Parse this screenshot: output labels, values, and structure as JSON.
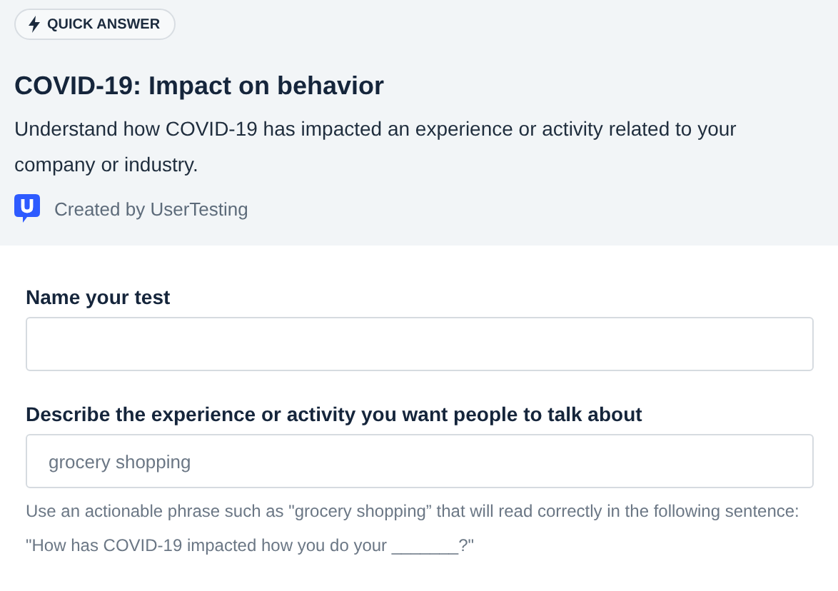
{
  "header": {
    "badge": "QUICK ANSWER",
    "title": "COVID-19: Impact on behavior",
    "description": "Understand how COVID-19 has impacted an experience or activity related to your company or industry.",
    "creator": "Created by UserTesting"
  },
  "form": {
    "fields": [
      {
        "label": "Name your test"
      },
      {
        "label": "Describe the experience or activity you want people to talk about",
        "placeholder": "grocery shopping",
        "help": "Use an actionable phrase such as \"grocery shopping” that will read correctly in the following sentence: \"How has COVID-19 impacted how you do your _______?\""
      }
    ]
  }
}
